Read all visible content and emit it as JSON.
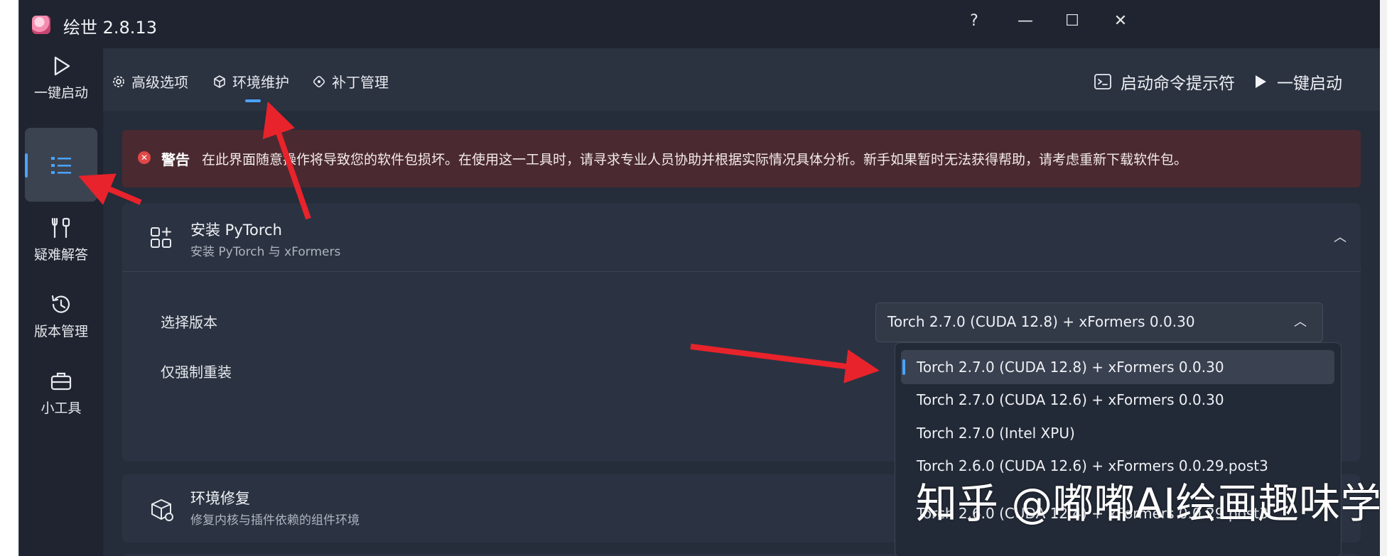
{
  "window": {
    "title": "绘世 2.8.13",
    "help": "?",
    "minimize": "—",
    "maximize": "☐",
    "close": "✕"
  },
  "sidebar": {
    "items": [
      {
        "label": "一键启动",
        "icon": "play-icon"
      },
      {
        "label": "",
        "icon": "list-icon",
        "active": true
      },
      {
        "label": "疑难解答",
        "icon": "tools-icon"
      },
      {
        "label": "版本管理",
        "icon": "history-icon"
      },
      {
        "label": "小工具",
        "icon": "toolbox-icon"
      }
    ]
  },
  "topnav": {
    "tabs": [
      {
        "label": "高级选项",
        "icon": "gear-icon"
      },
      {
        "label": "环境维护",
        "icon": "package-icon",
        "active": true
      },
      {
        "label": "补丁管理",
        "icon": "patch-icon"
      }
    ],
    "terminal_label": "启动命令提示符",
    "launch_label": "一键启动"
  },
  "warning": {
    "title": "警告",
    "text": "在此界面随意操作将导致您的软件包损坏。在使用这一工具时，请寻求专业人员协助并根据实际情况具体分析。新手如果暂时无法获得帮助，请考虑重新下载软件包。"
  },
  "pytorch": {
    "title": "安装 PyTorch",
    "subtitle": "安装 PyTorch 与 xFormers",
    "select_label": "选择版本",
    "force_label": "仅强制重装",
    "selected": "Torch 2.7.0 (CUDA 12.8) + xFormers 0.0.30",
    "options": [
      "Torch 2.7.0 (CUDA 12.8) + xFormers 0.0.30",
      "Torch 2.7.0 (CUDA 12.6) + xFormers 0.0.30",
      "Torch 2.7.0 (Intel XPU)",
      "Torch 2.6.0 (CUDA 12.6) + xFormers 0.0.29.post3",
      "Torch 2.6.0 (CUDA 12.4) + xFormers 0.0.29.post3"
    ]
  },
  "repair": {
    "title": "环境修复",
    "subtitle": "修复内核与插件依赖的组件环境"
  },
  "watermark": "知乎 @嘟嘟AI绘画趣味学",
  "colors": {
    "accent": "#4aa3ff",
    "warning_bg": "#4a2a30",
    "arrow": "#e8232b"
  }
}
